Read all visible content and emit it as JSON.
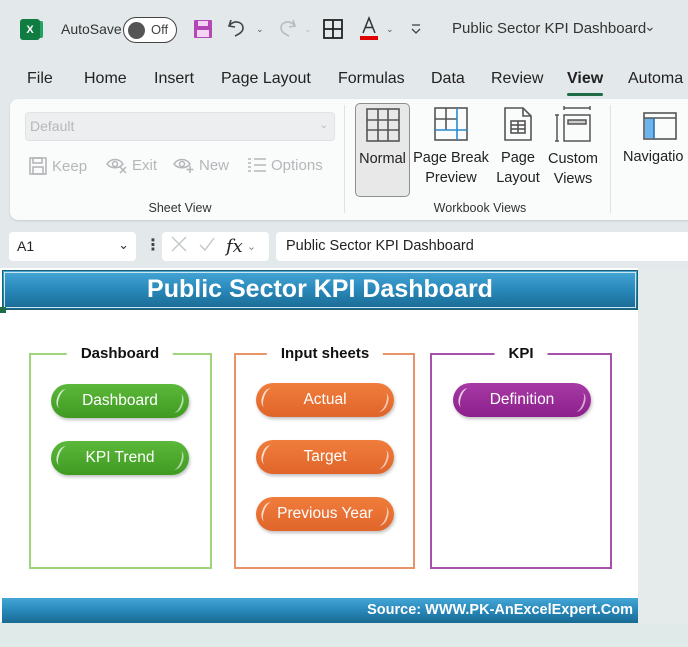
{
  "titlebar": {
    "app_icon": "excel-logo-icon",
    "app_icon_letter": "X",
    "autosave_label": "AutoSave",
    "autosave_state": "Off",
    "doc_title": "Public Sector KPI Dashboard",
    "icons": [
      "save-icon",
      "undo-icon",
      "redo-icon",
      "borders-icon",
      "font-color-icon",
      "customize-qat-icon"
    ],
    "colors": {
      "save_icon": "#b447b6",
      "font_color_bar": "#e00000"
    }
  },
  "tabs": [
    {
      "label": "File"
    },
    {
      "label": "Home"
    },
    {
      "label": "Insert"
    },
    {
      "label": "Page Layout"
    },
    {
      "label": "Formulas"
    },
    {
      "label": "Data"
    },
    {
      "label": "Review"
    },
    {
      "label": "View",
      "active": true
    },
    {
      "label": "Automa"
    }
  ],
  "ribbon": {
    "sheet_view": {
      "select_value": "Default",
      "buttons": [
        {
          "label": "Keep",
          "icon": "save-icon"
        },
        {
          "label": "Exit",
          "icon": "eye-exit-icon"
        },
        {
          "label": "New",
          "icon": "eye-new-icon"
        },
        {
          "label": "Options",
          "icon": "list-options-icon"
        }
      ],
      "group_label": "Sheet View"
    },
    "workbook_views": {
      "buttons": [
        {
          "label_line1": "Normal",
          "label_line2": "",
          "icon": "normal-view-icon",
          "selected": true
        },
        {
          "label_line1": "Page Break",
          "label_line2": "Preview",
          "icon": "page-break-preview-icon"
        },
        {
          "label_line1": "Page",
          "label_line2": "Layout",
          "icon": "page-layout-icon"
        },
        {
          "label_line1": "Custom",
          "label_line2": "Views",
          "icon": "custom-views-icon"
        }
      ],
      "group_label": "Workbook Views"
    },
    "show": {
      "buttons": [
        {
          "label": "Navigatio",
          "icon": "navigation-pane-icon"
        }
      ]
    }
  },
  "formula_bar": {
    "name_box": "A1",
    "fx_label": "fx",
    "formula": "Public Sector KPI Dashboard"
  },
  "sheet": {
    "banner_title": "Public Sector KPI Dashboard",
    "groups": [
      {
        "title": "Dashboard",
        "color": "#92d050",
        "buttons": [
          {
            "label": "Dashboard"
          },
          {
            "label": "KPI Trend"
          }
        ]
      },
      {
        "title": "Input sheets",
        "color": "#e8824e",
        "buttons": [
          {
            "label": "Actual"
          },
          {
            "label": "Target"
          },
          {
            "label": "Previous Year"
          }
        ]
      },
      {
        "title": "KPI",
        "color": "#9e45a3",
        "buttons": [
          {
            "label": "Definition"
          }
        ]
      }
    ],
    "footer": "Source: WWW.PK-AnExcelExpert.Com",
    "colors": {
      "banner": "#2685b6",
      "green_button": "#4aa72a",
      "orange_button": "#e8702f",
      "purple_button": "#9a2c99"
    }
  }
}
